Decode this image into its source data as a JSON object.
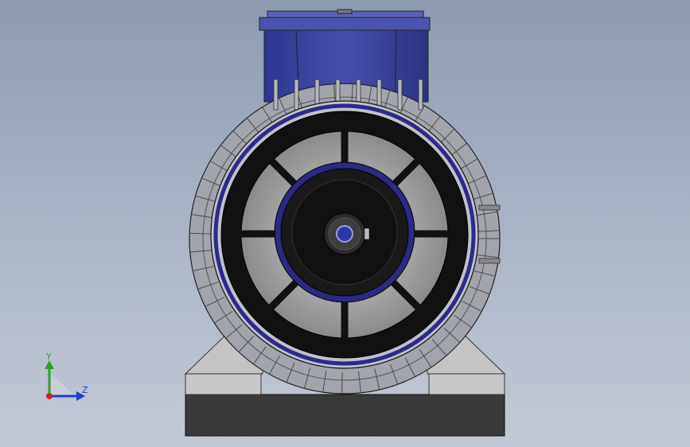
{
  "viewport": {
    "background_top": "#8e9bb0",
    "background_bottom": "#c2c9d6"
  },
  "model": {
    "terminal_box_color": "#3e47a0",
    "housing_color": "#9a9ca4",
    "fan_cover_color": "#1c1c1c",
    "grille_color": "#b0b0b0",
    "ring_color": "#2b2b8a",
    "base_color": "#3a3a3a",
    "feet_color": "#b8b8b8"
  },
  "triad": {
    "y_label": "Y",
    "z_label": "Z",
    "y_color": "#2ca02c",
    "z_color": "#1f3fd0",
    "x_color": "#d02020"
  }
}
